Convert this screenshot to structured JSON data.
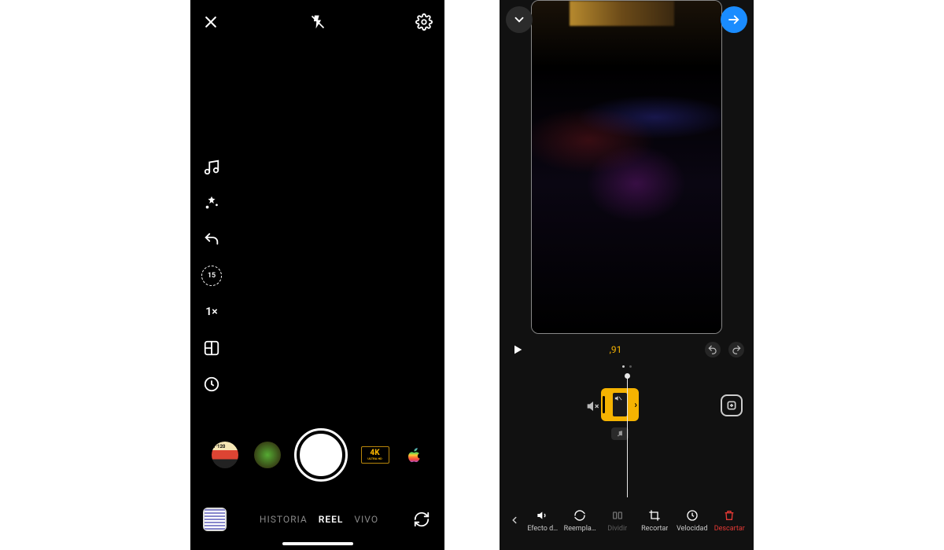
{
  "camera": {
    "side": {
      "timer_value": "15",
      "speed_label": "1×"
    },
    "filters": {
      "fourk_top": "4K",
      "fourk_bottom": "ULTRA HD"
    },
    "modes": {
      "historia": "HISTORIA",
      "reel": "REEL",
      "vivo": "VIVO"
    }
  },
  "editor": {
    "time_text": ",91",
    "toolbar": {
      "efecto": "Efecto d…",
      "reemplazar": "Reempla…",
      "dividir": "Dividir",
      "recortar": "Recortar",
      "velocidad": "Velocidad",
      "descartar": "Descartar"
    }
  }
}
